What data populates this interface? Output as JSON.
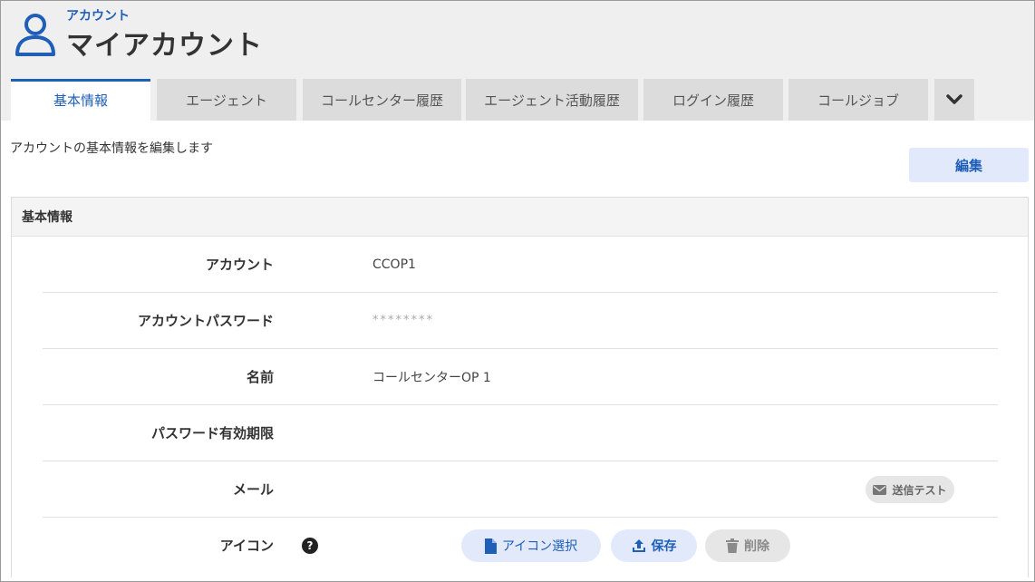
{
  "header": {
    "breadcrumb": "アカウント",
    "title": "マイアカウント"
  },
  "tabs": [
    {
      "label": "基本情報",
      "active": true
    },
    {
      "label": "エージェント",
      "active": false
    },
    {
      "label": "コールセンター履歴",
      "active": false
    },
    {
      "label": "エージェント活動履歴",
      "active": false
    },
    {
      "label": "ログイン履歴",
      "active": false
    },
    {
      "label": "コールジョブ",
      "active": false
    }
  ],
  "tab_more_icon": "chevron-down-icon",
  "main": {
    "description": "アカウントの基本情報を編集します",
    "edit_label": "編集"
  },
  "panel": {
    "title": "基本情報",
    "rows": [
      {
        "label": "アカウント",
        "value": "CCOP1"
      },
      {
        "label": "アカウントパスワード",
        "value": "********"
      },
      {
        "label": "名前",
        "value": "コールセンターOP 1"
      },
      {
        "label": "パスワード有効期限",
        "value": ""
      },
      {
        "label": "メール",
        "value": ""
      },
      {
        "label": "アイコン",
        "value": ""
      }
    ],
    "send_test_label": "送信テスト",
    "help_glyph": "?",
    "icon_buttons": {
      "select_label": "アイコン選択",
      "save_label": "保存",
      "delete_label": "削除"
    }
  },
  "colors": {
    "accent": "#1f5fb8",
    "button_bg": "#e2e9fb",
    "header_bg": "#efefef",
    "tab_bg": "#dcdcdc"
  }
}
